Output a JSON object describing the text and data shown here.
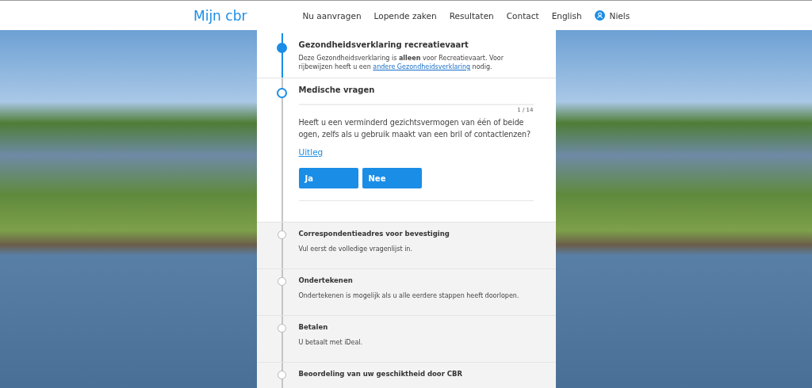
{
  "header": {
    "logo": "Mijn cbr",
    "nav": [
      "Nu aanvragen",
      "Lopende zaken",
      "Resultaten",
      "Contact",
      "English"
    ],
    "user": "Niels"
  },
  "steps": [
    {
      "kind": "done",
      "title": "Gezondheidsverklaring recreatievaart",
      "text": "Deze Gezondheidsverklaring is **alleen** voor Recreatievaart. Voor rijbewijzen heeft u een",
      "link": "andere Gezondheidsverklaring",
      "text_after": "nodig."
    },
    {
      "kind": "current",
      "title": "Medische vragen",
      "counter": "1 / 14",
      "question": "Heeft u een verminderd gezichtsvermogen van één of beide ogen, zelfs als u gebruik maakt van een bril of contactlenzen?",
      "help_link": "Uitleg",
      "answers": [
        "Ja",
        "Nee"
      ]
    },
    {
      "kind": "pending",
      "title": "Correspondentieadres voor bevestiging",
      "text": "Vul eerst de volledige vragenlijst in."
    },
    {
      "kind": "pending",
      "title": "Ondertekenen",
      "text": "Ondertekenen is mogelijk als u alle eerdere stappen heeft doorlopen."
    },
    {
      "kind": "pending",
      "title": "Betalen",
      "text": "U betaalt met iDeal."
    },
    {
      "kind": "pending",
      "title": "Beoordeling van uw geschiktheid door CBR"
    }
  ]
}
